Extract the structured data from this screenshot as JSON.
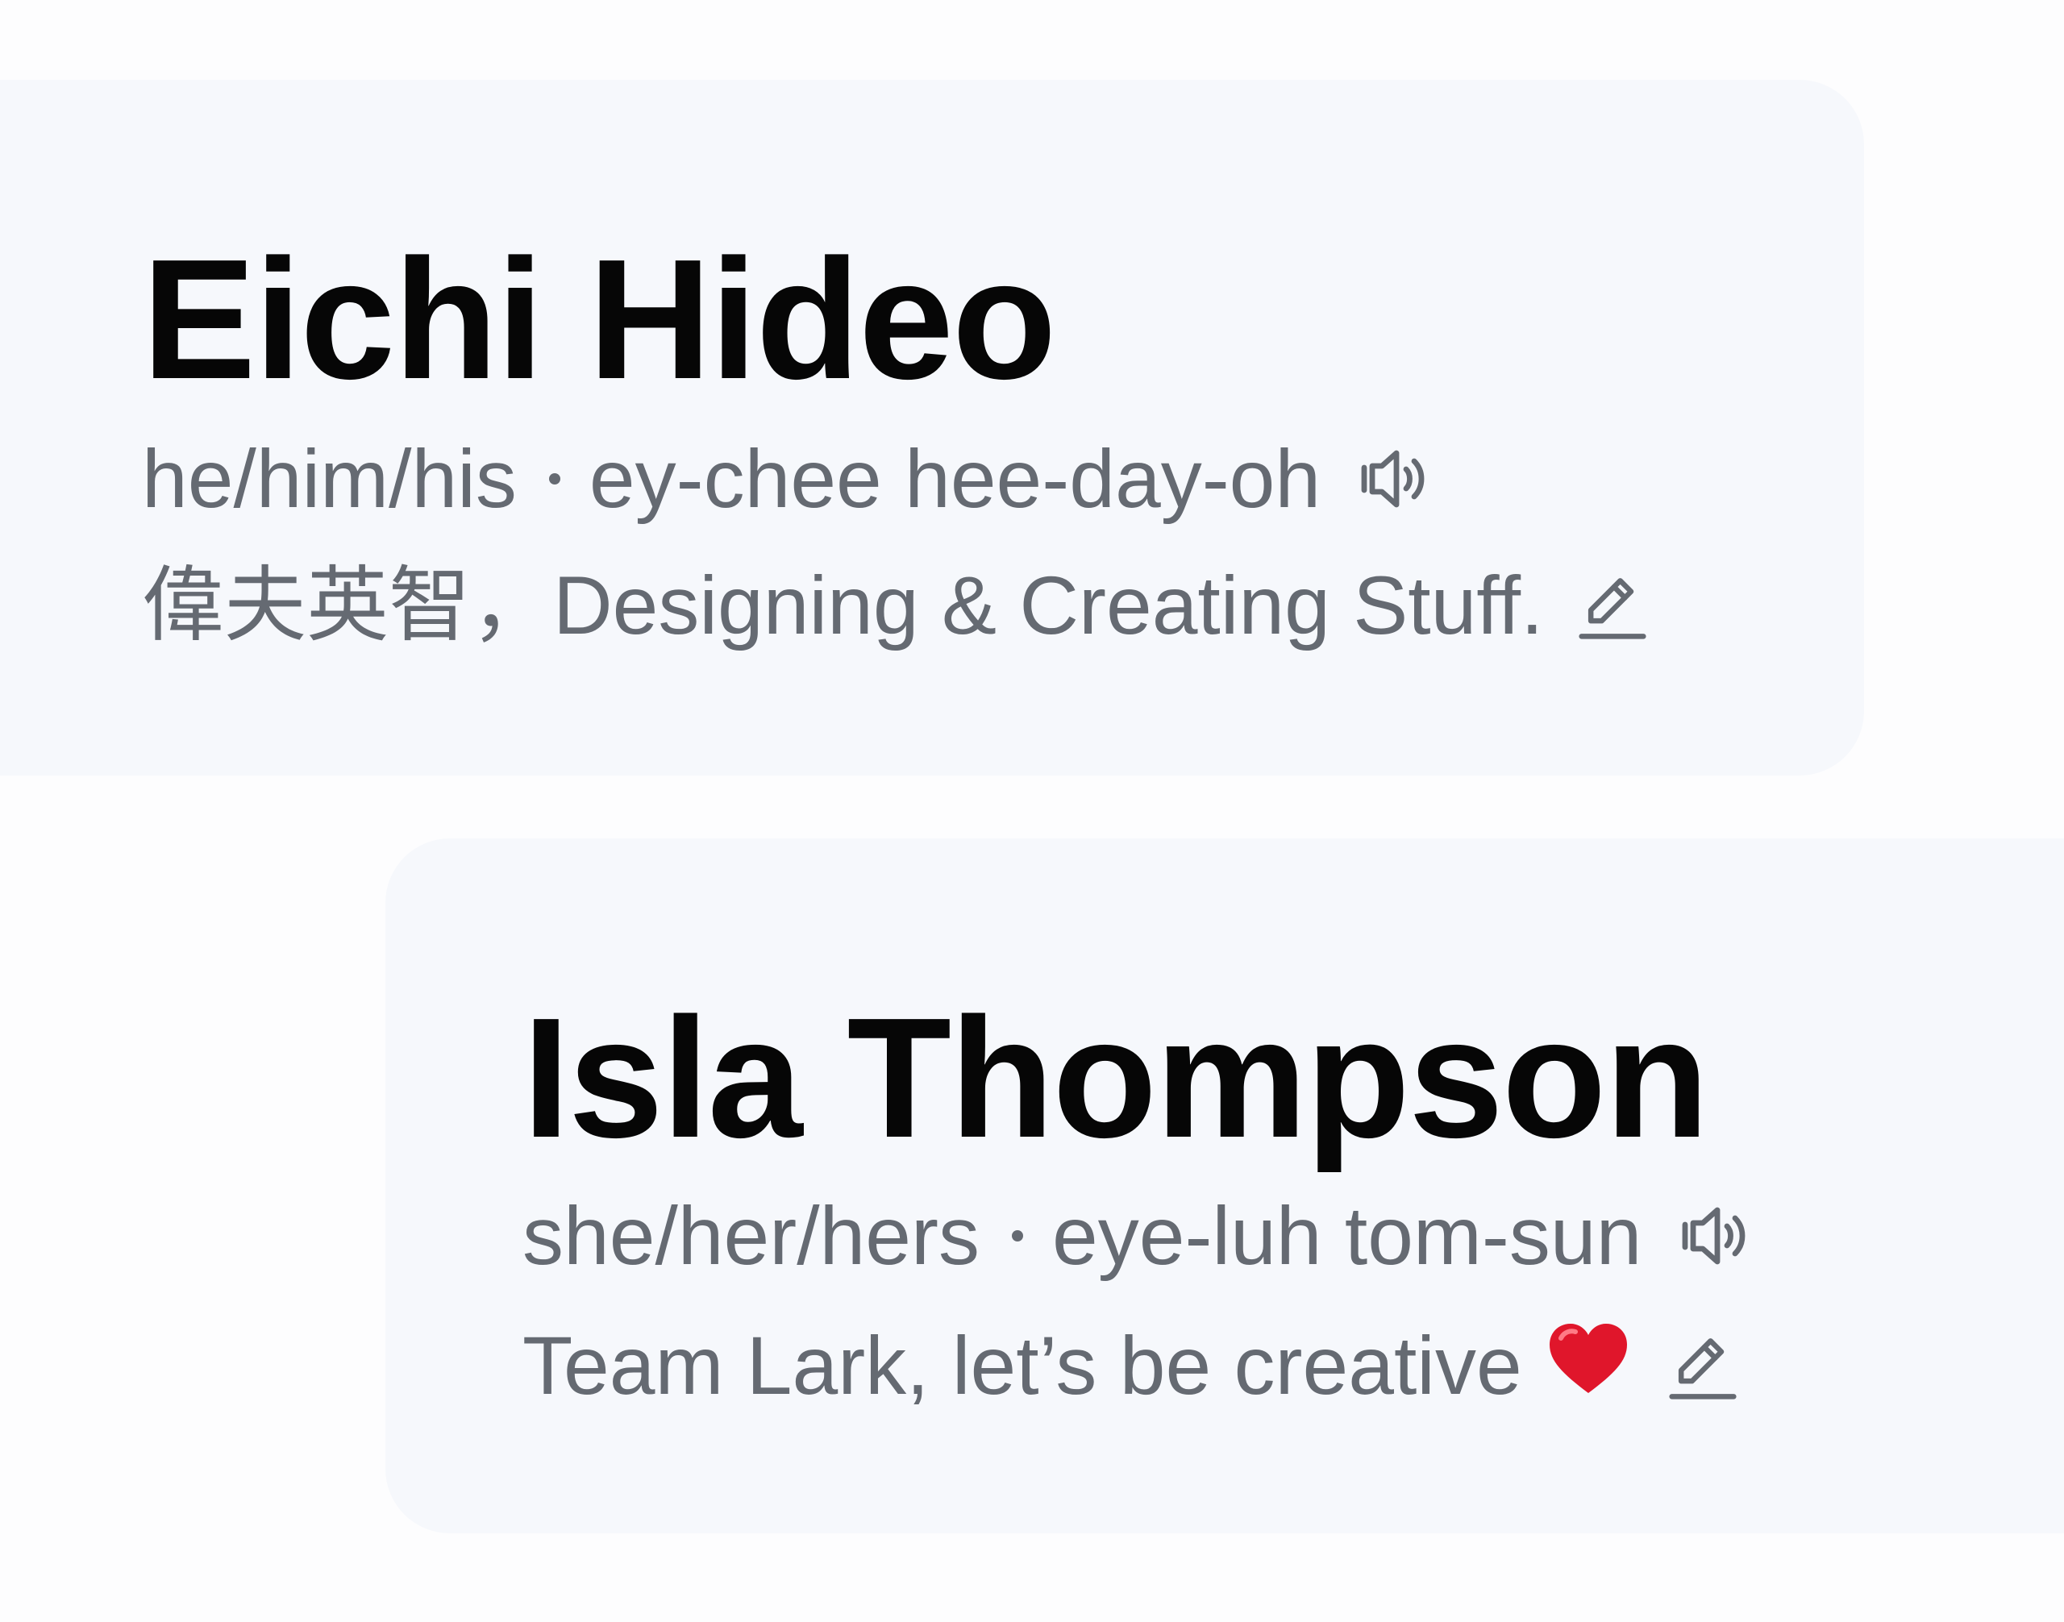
{
  "profiles": [
    {
      "name": "Eichi Hideo",
      "pronouns": "he/him/his",
      "pronunciation": "ey-chee hee-day-oh",
      "status": "偉夫英智，Designing & Creating Stuff.",
      "status_emoji": "",
      "audio_icon": "speaker-icon",
      "edit_icon": "pencil-icon"
    },
    {
      "name": "Isla Thompson",
      "pronouns": "she/her/hers",
      "pronunciation": "eye-luh tom-sun",
      "status": "Team Lark, let’s be creative",
      "status_emoji": "❤️",
      "audio_icon": "speaker-icon",
      "edit_icon": "pencil-icon"
    }
  ],
  "colors": {
    "card_background": "#f6f8fc",
    "page_background": "#fdfdfe",
    "name_text": "#060606",
    "secondary_text": "#656a72",
    "heart": "#e0162b"
  }
}
